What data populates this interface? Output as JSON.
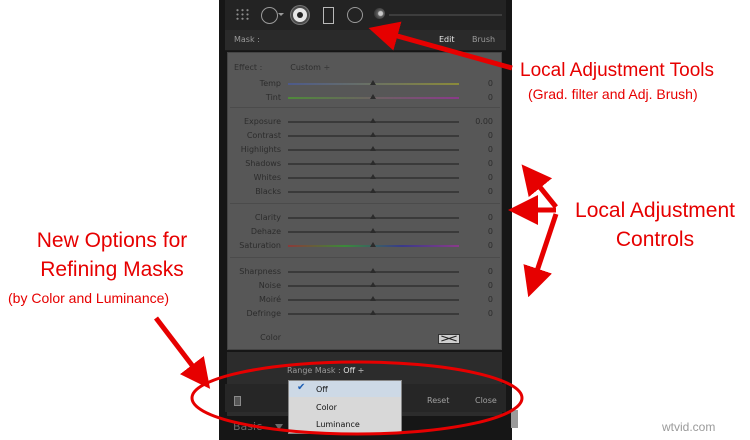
{
  "toolbar": {
    "tools": [
      "grid-icon",
      "spot-removal-icon",
      "red-eye-icon",
      "graduated-filter-icon",
      "radial-filter-icon",
      "adjustment-brush-icon"
    ]
  },
  "mask_bar": {
    "label": "Mask :",
    "edit": "Edit",
    "brush": "Brush"
  },
  "effect": {
    "label": "Effect :",
    "value": "Custom ÷"
  },
  "sliders": [
    {
      "label": "Temp",
      "value": "0"
    },
    {
      "label": "Tint",
      "value": "0"
    },
    {
      "label": "Exposure",
      "value": "0.00"
    },
    {
      "label": "Contrast",
      "value": "0"
    },
    {
      "label": "Highlights",
      "value": "0"
    },
    {
      "label": "Shadows",
      "value": "0"
    },
    {
      "label": "Whites",
      "value": "0"
    },
    {
      "label": "Blacks",
      "value": "0"
    },
    {
      "label": "Clarity",
      "value": "0"
    },
    {
      "label": "Dehaze",
      "value": "0"
    },
    {
      "label": "Saturation",
      "value": "0"
    },
    {
      "label": "Sharpness",
      "value": "0"
    },
    {
      "label": "Noise",
      "value": "0"
    },
    {
      "label": "Moiré",
      "value": "0"
    },
    {
      "label": "Defringe",
      "value": "0"
    }
  ],
  "color_label": "Color",
  "range_mask": {
    "label": "Range Mask :",
    "value": "Off ÷"
  },
  "dropdown": {
    "options": [
      "Off",
      "Color",
      "Luminance"
    ],
    "selected": "Off"
  },
  "buttons": {
    "reset": "Reset",
    "close": "Close"
  },
  "next_panel": "Basic",
  "annotations": {
    "tools_title": "Local Adjustment Tools",
    "tools_sub": "(Grad. filter and Adj. Brush)",
    "controls": "Local Adjustment Controls",
    "masks_title": "New Options for Refining Masks",
    "masks_sub": "(by Color and Luminance)"
  },
  "watermark": "wtvid.com",
  "colors": {
    "annotation": "#e60000",
    "panel_bg": "#575757",
    "dark_bg": "#161616"
  }
}
